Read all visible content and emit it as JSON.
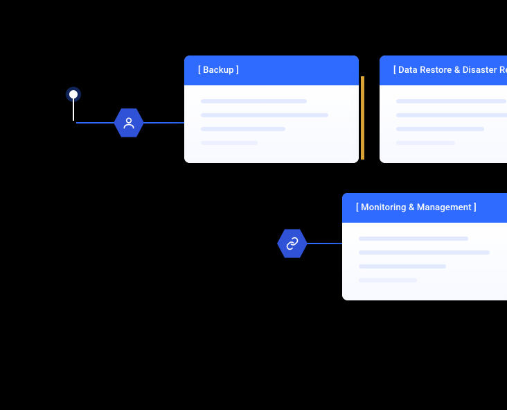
{
  "nodes": {
    "user_icon": "user-icon",
    "link_icon": "link-icon"
  },
  "cards": {
    "backup": {
      "title": "[ Backup ]"
    },
    "restore": {
      "title": "[ Data Restore & Disaster Recovery ]"
    },
    "monitoring": {
      "title": "[ Monitoring & Management ]"
    }
  },
  "colors": {
    "primary": "#2f6bff",
    "hex": "#2f52d6",
    "accent": "#f3b73e"
  }
}
